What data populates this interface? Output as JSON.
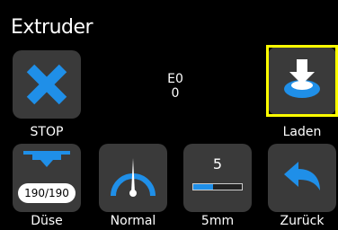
{
  "screen": {
    "title": "Extruder"
  },
  "status": {
    "extruder": "E0",
    "value": "0"
  },
  "buttons": {
    "stop": "STOP",
    "load": "Laden",
    "nozzle": "Düse",
    "speed": "Normal",
    "step": "5mm",
    "back": "Zurück"
  },
  "nozzle": {
    "temp": "190/190"
  },
  "step": {
    "value": "5",
    "level_percent": 40
  },
  "colors": {
    "accent": "#1f8fe8",
    "tile": "#3a3a3a",
    "selection": "#ffff00"
  }
}
